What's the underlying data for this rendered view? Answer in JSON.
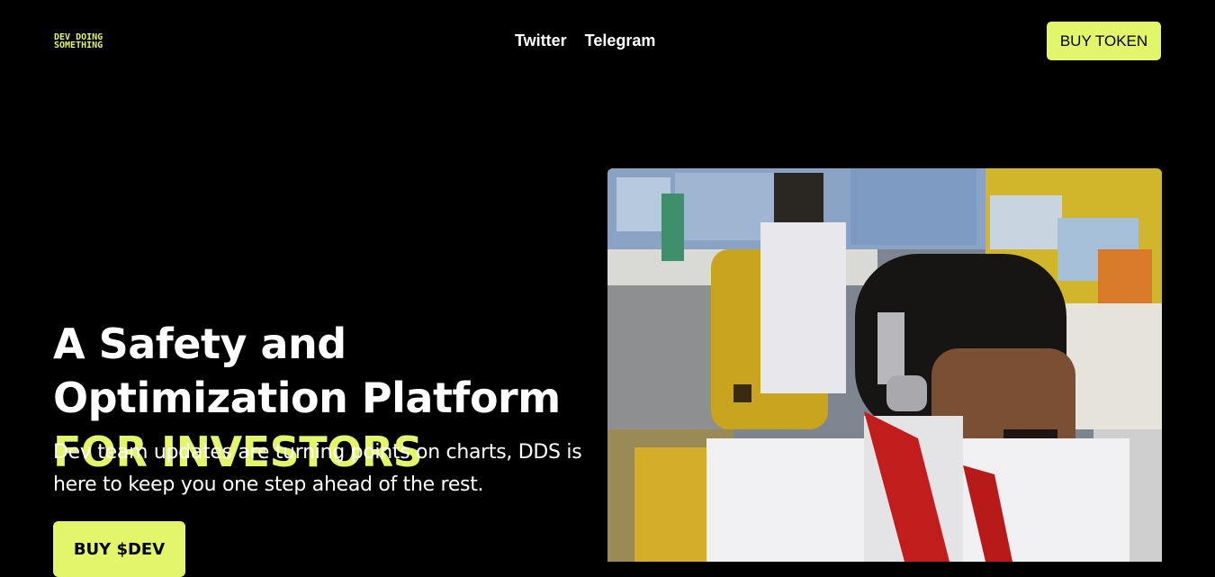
{
  "header": {
    "logo_line1": "DEV DOING",
    "logo_line2": "SOMETHING",
    "nav_links": [
      "Twitter",
      "Telegram"
    ],
    "cta_label": "BUY TOKEN"
  },
  "hero": {
    "title_main": "A Safety and Optimization Platform ",
    "title_accent": "FOR INVESTORS",
    "subtitle": "Dev team updates are turning points on charts, DDS is here to keep you one step ahead of the rest.",
    "cta_label": "BUY $DEV"
  },
  "colors": {
    "accent": "#e3f56a",
    "background": "#000000",
    "text": "#ffffff"
  }
}
